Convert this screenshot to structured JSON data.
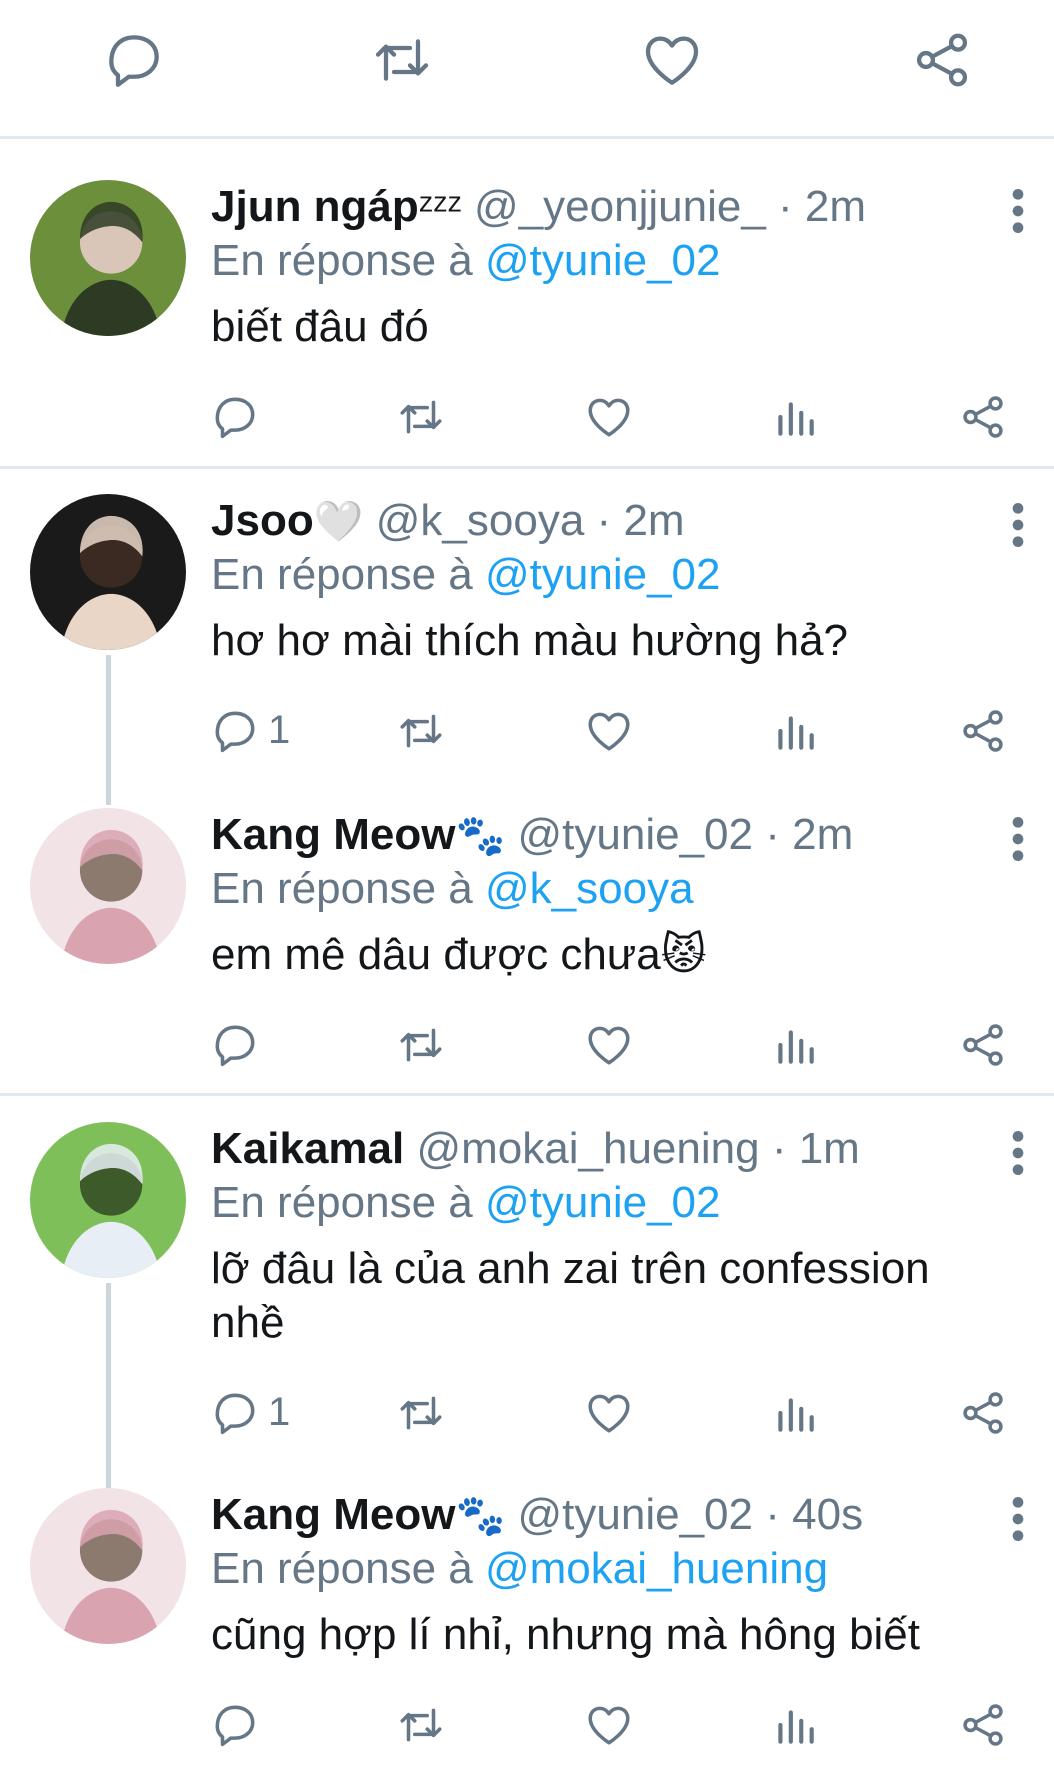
{
  "colors": {
    "icon": "#657786",
    "mention": "#1da1f2",
    "separator": "#e1e8ed",
    "thread_line": "#ccd6dd"
  },
  "top_actions": [
    "reply-icon",
    "retweet-icon",
    "like-icon",
    "share-icon"
  ],
  "replies": [
    {
      "name": "Jjun ngáp",
      "name_suffix": "ᶻᶻᶻ",
      "handle": "@_yeonjjunie_",
      "dot": "·",
      "time": "2m",
      "reply_prefix": "En réponse à",
      "reply_to": "@tyunie_02",
      "text": "biết đâu đó",
      "reply_count": ""
    },
    {
      "name": "Jsoo",
      "name_suffix": "🤍",
      "handle": "@k_sooya",
      "dot": "·",
      "time": "2m",
      "reply_prefix": "En réponse à",
      "reply_to": "@tyunie_02",
      "text": "hơ hơ mài thích màu hường hả?",
      "reply_count": "1"
    },
    {
      "name": "Kang Meow",
      "name_suffix": "🐾",
      "handle": "@tyunie_02",
      "dot": "·",
      "time": "2m",
      "reply_prefix": "En réponse à",
      "reply_to": "@k_sooya",
      "text": "em mê dâu được chưa😾",
      "reply_count": ""
    },
    {
      "name": "Kaikamal",
      "name_suffix": "",
      "handle": "@mokai_huening",
      "dot": "·",
      "time": "1m",
      "reply_prefix": "En réponse à",
      "reply_to": "@tyunie_02",
      "text": "lỡ đâu là của anh zai trên confession nhề",
      "reply_count": "1"
    },
    {
      "name": "Kang Meow",
      "name_suffix": "🐾",
      "handle": "@tyunie_02",
      "dot": "·",
      "time": "40s",
      "reply_prefix": "En réponse à",
      "reply_to": "@mokai_huening",
      "text": "cũng hợp lí nhỉ, nhưng mà hông biết",
      "reply_count": ""
    }
  ]
}
